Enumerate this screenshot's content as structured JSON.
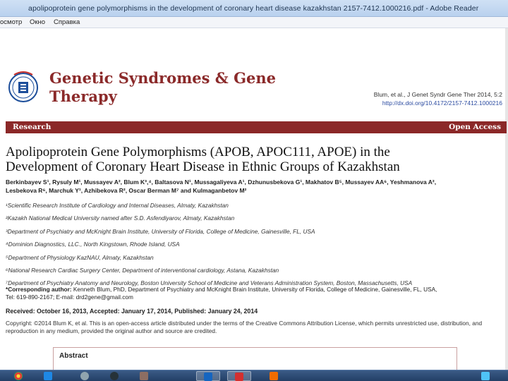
{
  "window": {
    "title": "apolipoprotein gene polymorphisms in the development of coronary heart disease kazakhstan 2157-7412.1000216.pdf - Adobe Reader"
  },
  "menu": {
    "items": [
      "осмотр",
      "Окно",
      "Справка"
    ]
  },
  "journal": {
    "title_line1": "Genetic Syndromes & Gene",
    "title_line2": "Therapy",
    "citation": "Blum, et al., J Genet Syndr Gene Ther 2014, 5:2",
    "doi": "http://dx.doi.org/10.4172/2157-7412.1000216"
  },
  "section_bar": {
    "left": "Research",
    "right": "Open Access"
  },
  "article": {
    "title_line1": "Apolipoprotein Gene Polymorphisms (APOB, APOC111, APOE) in the",
    "title_line2": "Development of Coronary Heart Disease in Ethnic Groups of Kazakhstan",
    "authors_line1": "Berkinbayev S¹, Rysuly M¹, Mussayev A², Blum K³,⁴, Baltasova N¹, Mussagaliyeva A¹, Dzhunusbekova G¹, Makhatov B⁵, Mussayev AA⁶, Yeshmanova A²,",
    "authors_line2": "Lesbekova R⁶, Marchuk Y¹, Azhibekova R², Oscar Berman M⁷ and Kulmaganbetov M²",
    "affiliations": [
      "¹Scientific Research Institute of Cardiology and Internal Diseases, Almaty, Kazakhstan",
      "²Kazakh National Medical University named after S.D. Asfendiyarov, Almaty, Kazakhstan",
      "³Department of Psychiatry and McKnight Brain Institute, University of Florida, College of Medicine, Gainesville, FL, USA",
      "⁴Dominion Diagnostics, LLC., North Kingstown, Rhode Island, USA",
      "⁵Department of Physiology KazNAU, Almaty, Kazakhstan",
      "⁶National Research Cardiac Surgery Center, Department of interventional cardiology, Astana, Kazakhstan",
      "⁷Department of Psychiatry Anatomy and Neurology, Boston University School of Medicine and Veterans Administration System, Boston, Massachusetts, USA"
    ],
    "corr_label": "*Corresponding author:",
    "corr_text": " Kenneth Blum, PhD, Department of Psychiatry and McKnight Brain Institute, University of Florida, College of Medicine, Gainesville, FL, USA,",
    "corr_contact": "Tel: 619-890-2167; E-mail: drd2gene@gmail.com",
    "dates": "Received: October 16, 2013, Accepted: January 17, 2014, Published: January 24, 2014",
    "copyright": "Copyright: ©2014 Blum K, et al. This is an open-access article distributed under the terms of the Creative Commons Attribution License, which permits unrestricted use, distribution, and reproduction in any medium, provided the original author and source are credited.",
    "abstract_label": "Abstract"
  },
  "taskbar": {
    "icons": [
      "chrome-icon",
      "media-icon",
      "settings-icon",
      "app-icon",
      "folder-icon",
      "word-icon",
      "acrobat-icon",
      "paint-icon",
      "explorer-icon"
    ]
  },
  "colors": {
    "brand": "#8b2828",
    "link": "#2a4aa0",
    "taskbar": "#233f66"
  }
}
